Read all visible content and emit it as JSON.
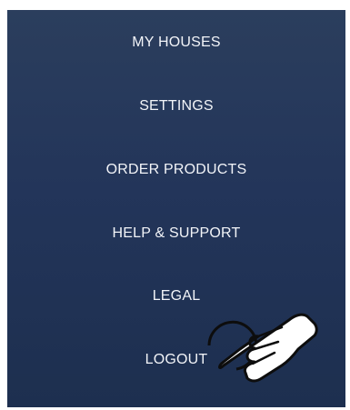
{
  "menu": {
    "items": [
      {
        "label": "MY HOUSES"
      },
      {
        "label": "SETTINGS"
      },
      {
        "label": "ORDER PRODUCTS"
      },
      {
        "label": "HELP & SUPPORT"
      },
      {
        "label": "LEGAL"
      },
      {
        "label": "LOGOUT"
      }
    ]
  },
  "overlay": {
    "icon": "tap-hand-icon"
  },
  "colors": {
    "panel_top": "#2b3e5d",
    "panel_bottom": "#1d2f4f",
    "text": "#f2f4f8"
  }
}
